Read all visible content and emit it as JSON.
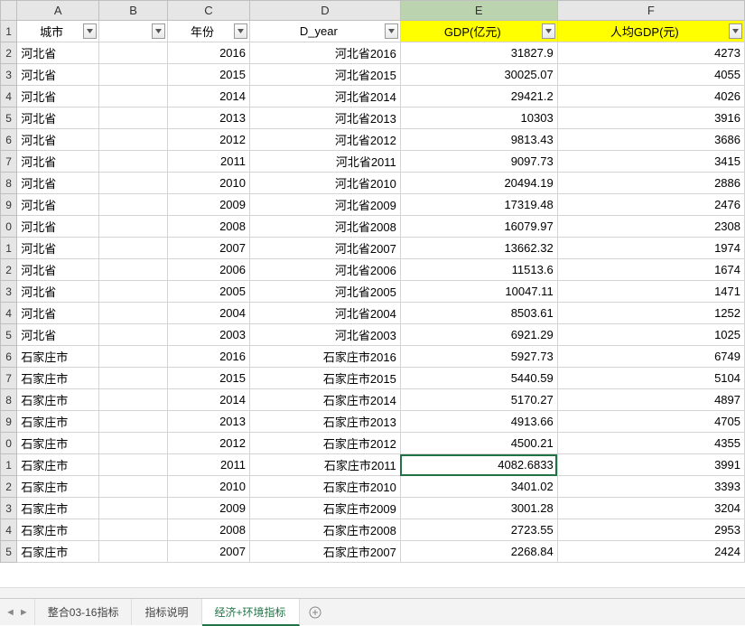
{
  "columns": [
    "A",
    "B",
    "C",
    "D",
    "E",
    "F"
  ],
  "selected_column": "E",
  "selected_cell": {
    "row_index": 19,
    "col": "E"
  },
  "header_row": {
    "A": {
      "label": "城市",
      "highlight": false
    },
    "B": {
      "label": "",
      "highlight": false
    },
    "C": {
      "label": "年份",
      "highlight": false
    },
    "D": {
      "label": "D_year",
      "highlight": false
    },
    "E": {
      "label": "GDP(亿元)",
      "highlight": true
    },
    "F": {
      "label": "人均GDP(元)",
      "highlight": true
    }
  },
  "row_numbers": [
    "1",
    "2",
    "3",
    "4",
    "5",
    "6",
    "7",
    "8",
    "9",
    "0",
    "1",
    "2",
    "3",
    "4",
    "5",
    "6",
    "7",
    "8",
    "9",
    "0",
    "1",
    "2",
    "3",
    "4",
    "5"
  ],
  "rows": [
    {
      "A": "河北省",
      "B": "",
      "C": "2016",
      "D": "河北省2016",
      "E": "31827.9",
      "F": "4273"
    },
    {
      "A": "河北省",
      "B": "",
      "C": "2015",
      "D": "河北省2015",
      "E": "30025.07",
      "F": "4055"
    },
    {
      "A": "河北省",
      "B": "",
      "C": "2014",
      "D": "河北省2014",
      "E": "29421.2",
      "F": "4026"
    },
    {
      "A": "河北省",
      "B": "",
      "C": "2013",
      "D": "河北省2013",
      "E": "10303",
      "F": "3916"
    },
    {
      "A": "河北省",
      "B": "",
      "C": "2012",
      "D": "河北省2012",
      "E": "9813.43",
      "F": "3686"
    },
    {
      "A": "河北省",
      "B": "",
      "C": "2011",
      "D": "河北省2011",
      "E": "9097.73",
      "F": "3415"
    },
    {
      "A": "河北省",
      "B": "",
      "C": "2010",
      "D": "河北省2010",
      "E": "20494.19",
      "F": "2886"
    },
    {
      "A": "河北省",
      "B": "",
      "C": "2009",
      "D": "河北省2009",
      "E": "17319.48",
      "F": "2476"
    },
    {
      "A": "河北省",
      "B": "",
      "C": "2008",
      "D": "河北省2008",
      "E": "16079.97",
      "F": "2308"
    },
    {
      "A": "河北省",
      "B": "",
      "C": "2007",
      "D": "河北省2007",
      "E": "13662.32",
      "F": "1974"
    },
    {
      "A": "河北省",
      "B": "",
      "C": "2006",
      "D": "河北省2006",
      "E": "11513.6",
      "F": "1674"
    },
    {
      "A": "河北省",
      "B": "",
      "C": "2005",
      "D": "河北省2005",
      "E": "10047.11",
      "F": "1471"
    },
    {
      "A": "河北省",
      "B": "",
      "C": "2004",
      "D": "河北省2004",
      "E": "8503.61",
      "F": "1252"
    },
    {
      "A": "河北省",
      "B": "",
      "C": "2003",
      "D": "河北省2003",
      "E": "6921.29",
      "F": "1025"
    },
    {
      "A": "石家庄市",
      "B": "",
      "C": "2016",
      "D": "石家庄市2016",
      "E": "5927.73",
      "F": "6749"
    },
    {
      "A": "石家庄市",
      "B": "",
      "C": "2015",
      "D": "石家庄市2015",
      "E": "5440.59",
      "F": "5104"
    },
    {
      "A": "石家庄市",
      "B": "",
      "C": "2014",
      "D": "石家庄市2014",
      "E": "5170.27",
      "F": "4897"
    },
    {
      "A": "石家庄市",
      "B": "",
      "C": "2013",
      "D": "石家庄市2013",
      "E": "4913.66",
      "F": "4705"
    },
    {
      "A": "石家庄市",
      "B": "",
      "C": "2012",
      "D": "石家庄市2012",
      "E": "4500.21",
      "F": "4355"
    },
    {
      "A": "石家庄市",
      "B": "",
      "C": "2011",
      "D": "石家庄市2011",
      "E": "4082.6833",
      "F": "3991"
    },
    {
      "A": "石家庄市",
      "B": "",
      "C": "2010",
      "D": "石家庄市2010",
      "E": "3401.02",
      "F": "3393"
    },
    {
      "A": "石家庄市",
      "B": "",
      "C": "2009",
      "D": "石家庄市2009",
      "E": "3001.28",
      "F": "3204"
    },
    {
      "A": "石家庄市",
      "B": "",
      "C": "2008",
      "D": "石家庄市2008",
      "E": "2723.55",
      "F": "2953"
    },
    {
      "A": "石家庄市",
      "B": "",
      "C": "2007",
      "D": "石家庄市2007",
      "E": "2268.84",
      "F": "2424"
    }
  ],
  "tabs": [
    {
      "label": "整合03-16指标",
      "active": false
    },
    {
      "label": "指标说明",
      "active": false
    },
    {
      "label": "经济+环境指标",
      "active": true
    }
  ]
}
